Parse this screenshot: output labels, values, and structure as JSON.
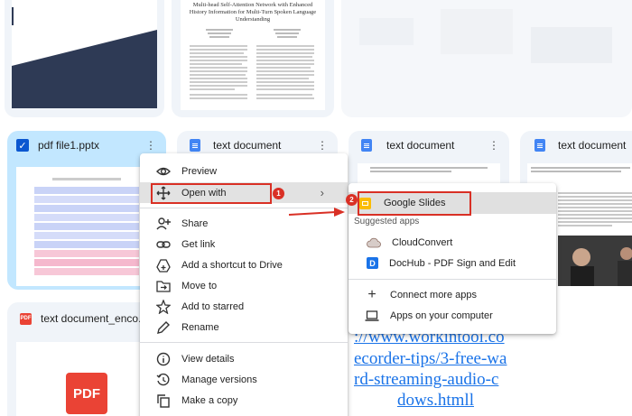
{
  "files": [
    {
      "name": "pdf file1.pptx",
      "icon": "check-icon"
    },
    {
      "name": "text document",
      "icon": "docs-icon"
    },
    {
      "name": "text document",
      "icon": "docs-icon"
    },
    {
      "name": "text document",
      "icon": "docs-icon"
    },
    {
      "name": "text document_enco...",
      "icon": "pdf-icon"
    }
  ],
  "paper_title": "Multi-head Self-Attention Network with Enhanced History Information for Multi-Turn Spoken Language Understanding",
  "pdf_logo": "PDF",
  "context_menu": {
    "preview": "Preview",
    "open_with": "Open with",
    "share": "Share",
    "get_link": "Get link",
    "add_shortcut": "Add a shortcut to Drive",
    "move_to": "Move to",
    "add_starred": "Add to starred",
    "rename": "Rename",
    "view_details": "View details",
    "manage_versions": "Manage versions",
    "make_copy": "Make a copy"
  },
  "submenu": {
    "google_slides": "Google Slides",
    "suggested_header": "Suggested apps",
    "cloudconvert": "CloudConvert",
    "dochub": "DocHub - PDF Sign and Edit",
    "connect_more": "Connect more apps",
    "apps_on_computer": "Apps on your computer"
  },
  "annotations": {
    "step1": "1",
    "step2": "2"
  },
  "link_lines": [
    "://www.workintool.co",
    "ecorder-tips/3-free-wa",
    "rd-streaming-audio-c",
    "dows.htmll"
  ],
  "colors": {
    "accent": "#0b57d0",
    "selected_card": "#c2e7ff",
    "annotation_red": "#d93025",
    "link": "#1a73e8"
  }
}
